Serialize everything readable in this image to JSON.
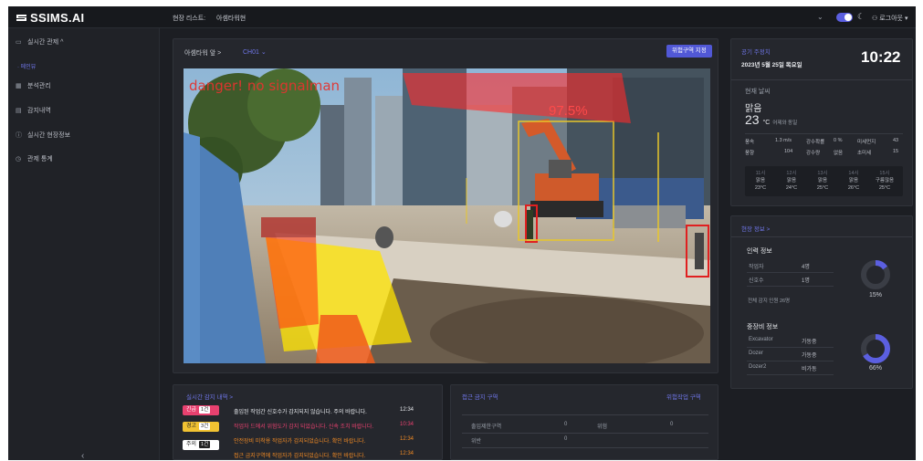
{
  "header": {
    "brand": "SSIMS.AI",
    "site_label": "현장 리스트:",
    "site_name": "아셈타워현",
    "chevron_icon": "chevron-down-icon",
    "user_label": "로그아웃 ▾",
    "accent": "#5b5fe0"
  },
  "sidebar": {
    "items": [
      {
        "label": "실시간 관제 ^",
        "icon": "camera-icon"
      },
      {
        "label": "메인뷰",
        "icon": "dot-icon"
      },
      {
        "label": "분석관리",
        "icon": "grid-icon"
      },
      {
        "label": "감지내역",
        "icon": "document-icon"
      },
      {
        "label": "실시간 현장정보",
        "icon": "info-icon"
      },
      {
        "label": "관제 통계",
        "icon": "clock-icon"
      }
    ],
    "collapse_icon": "chevron-left-icon"
  },
  "video": {
    "camera_title": "아셈타워 앞 >",
    "camera_id": "CH01 ⌄",
    "zone_button": "위험구역 지정",
    "overlay_text": "danger! no signalman",
    "confidence_text": "97.5%"
  },
  "alerts": {
    "title": "실시간 감지 내역 >",
    "badges": [
      {
        "label": "긴급",
        "count": "1건",
        "color": "#e8416f"
      },
      {
        "label": "경고",
        "count": "3건",
        "color": "#f1c232"
      },
      {
        "label": "주의",
        "count": "1건",
        "color": "#ffffff"
      }
    ],
    "rows": [
      {
        "message": "출입된 작업간 신호수가 감지되지 않습니다. 주의 바랍니다.",
        "time": "12:34",
        "color": "#e6e8ec"
      },
      {
        "message": "작업자 드에서 위험도가 감지 되었습니다. 신속 조치 바랍니다.",
        "time": "10:34",
        "color": "#e8416f"
      },
      {
        "message": "안전장비 미착용 작업자가 감지되었습니다. 확인 바랍니다.",
        "time": "12:34",
        "color": "#f08a24"
      },
      {
        "message": "접근 금지구역에 작업자가 감지되었습니다. 확인 바랍니다.",
        "time": "12:34",
        "color": "#f08a24"
      }
    ]
  },
  "zones": {
    "title": "접근 금지 구역",
    "link": "위험작업 구역",
    "cells": [
      "출입제한구역",
      "0",
      "위험",
      "0",
      "위반",
      "0"
    ]
  },
  "weather": {
    "title": "공기 주정치",
    "date": "2023년 5월 25일 목요일",
    "clock": "10:22",
    "today_label": "현재 날씨",
    "condition": "맑음",
    "temp": "23",
    "unit": "°C",
    "compare": "어제와 동일",
    "stats": [
      {
        "k": "풍속",
        "v": "1.3 m/s"
      },
      {
        "k": "강수확률",
        "v": "0 %"
      },
      {
        "k": "미세먼지",
        "v": "43"
      },
      {
        "k": "풍향",
        "v": "104"
      },
      {
        "k": "강수량",
        "v": "없음"
      },
      {
        "k": "초미세",
        "v": "15"
      }
    ],
    "forecast": [
      {
        "time": "11시",
        "cond": "맑음",
        "temp": "23°C"
      },
      {
        "time": "12시",
        "cond": "맑음",
        "temp": "24°C"
      },
      {
        "time": "13시",
        "cond": "맑음",
        "temp": "25°C"
      },
      {
        "time": "14시",
        "cond": "맑음",
        "temp": "26°C"
      },
      {
        "time": "15시",
        "cond": "구름많음",
        "temp": "25°C"
      }
    ]
  },
  "site_info": {
    "title": "현장 정보 >",
    "people_title": "인력 정보",
    "people": [
      {
        "k": "작업자",
        "v": "4명"
      },
      {
        "k": "신호수",
        "v": "1명"
      }
    ],
    "total": "전체 감지 인원 26명",
    "people_percent": "15%",
    "people_ratio": 0.15,
    "equip_title": "중장비 정보",
    "equip": [
      {
        "k": "Excavator",
        "v": "가동중"
      },
      {
        "k": "Dozer",
        "v": "가동중"
      },
      {
        "k": "Dozer2",
        "v": "비가동"
      }
    ],
    "equip_percent": "66%",
    "equip_ratio": 0.66
  }
}
